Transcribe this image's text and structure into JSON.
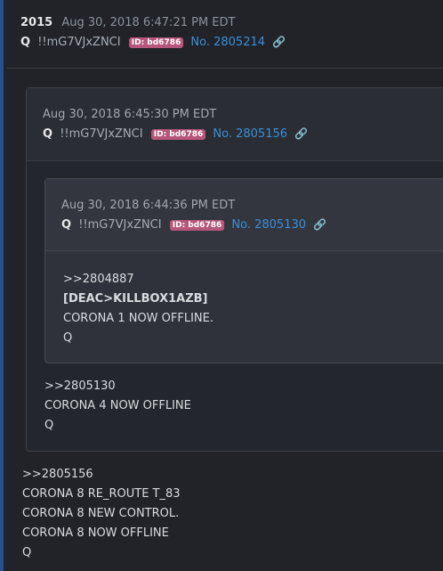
{
  "outer": {
    "post_number": "2015",
    "date": "Aug 30, 2018 6:47:21 PM EDT",
    "author": "Q",
    "tripcode": "!!mG7VJxZNCI",
    "id_badge": "ID: bd6786",
    "post_no": "No. 2805214",
    "body": [
      ">>2805156",
      "CORONA 8 RE_ROUTE T_83",
      "CORONA 8 NEW CONTROL.",
      "CORONA 8 NOW OFFLINE",
      "Q"
    ]
  },
  "quote1": {
    "date": "Aug 30, 2018 6:45:30 PM EDT",
    "author": "Q",
    "tripcode": "!!mG7VJxZNCI",
    "id_badge": "ID: bd6786",
    "post_no": "No. 2805156",
    "body": [
      ">>2805130",
      "CORONA 4 NOW OFFLINE",
      "Q"
    ]
  },
  "quote2": {
    "date": "Aug 30, 2018 6:44:36 PM EDT",
    "author": "Q",
    "tripcode": "!!mG7VJxZNCI",
    "id_badge": "ID: bd6786",
    "post_no": "No. 2805130",
    "body": [
      ">>2804887",
      "[DEAC>KILLBOX1AZB]",
      "CORONA 1 NOW OFFLINE.",
      "Q"
    ]
  },
  "icons": {
    "link": "link-icon"
  },
  "colors": {
    "accent": "#24508f",
    "link": "#3a8fd9",
    "id_badge": "#b5567a"
  }
}
